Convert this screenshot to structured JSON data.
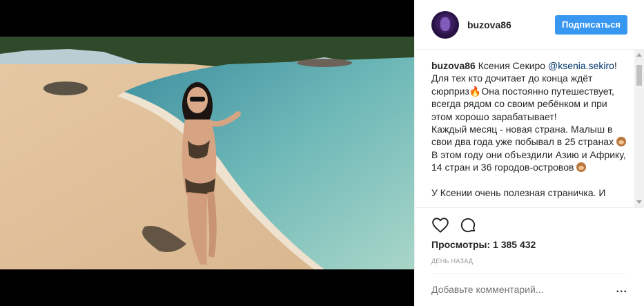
{
  "header": {
    "username": "buzova86",
    "follow_label": "Подписаться"
  },
  "media": {
    "description_icon": "video-frame"
  },
  "caption": {
    "author": "buzova86",
    "seg1": " Ксения Секиро ",
    "mention": "@ksenia.sekiro",
    "seg2": "! Для тех кто дочитает до конца ждёт сюрприз",
    "fire": "🔥",
    "seg3": "Она постоянно путешествует, всегда рядом со своим ребёнком и при этом хорошо зарабатывает!\nКаждый месяц - новая страна. Малыш в свои два года уже побывал в 25 странах ",
    "seg4": "В этом году они объездили Азию и Африку, 14 стран и 36 городов-островов ",
    "seg5": "\n\nУ Ксении очень полезная страничка. И"
  },
  "actions": {
    "like_icon": "heart-icon",
    "comment_icon": "comment-icon"
  },
  "stats": {
    "views": "Просмотры: 1 385 432",
    "time": "ДЕНЬ НАЗАД"
  },
  "comment": {
    "placeholder": "Добавьте комментарий...",
    "more_label": "..."
  },
  "colors": {
    "accent": "#3897f0",
    "mention": "#003569",
    "muted": "#999999"
  }
}
